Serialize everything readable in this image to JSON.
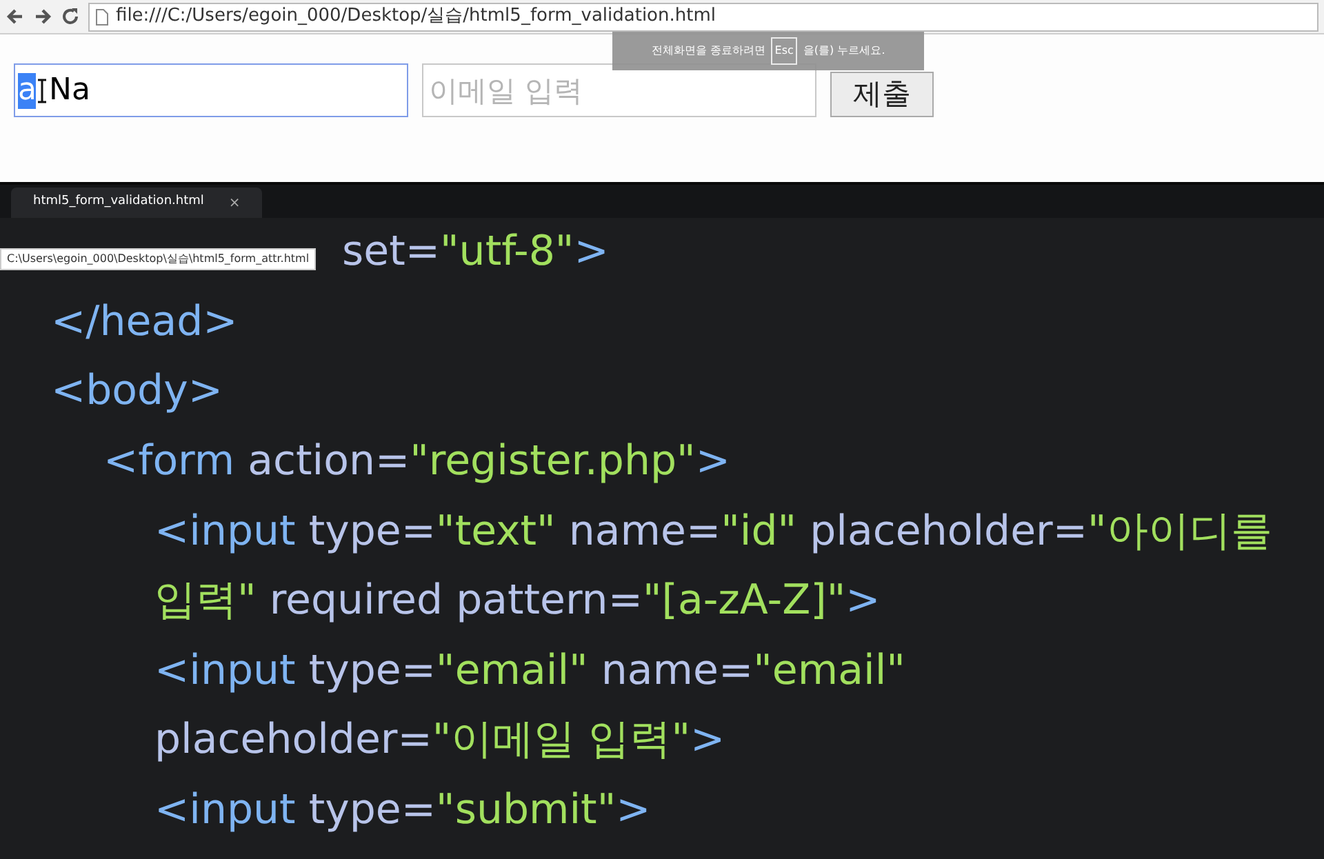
{
  "browser": {
    "url": "file:///C:/Users/egoin_000/Desktop/실습/html5_form_validation.html"
  },
  "fullscreen_notice": {
    "before": "전체화면을 종료하려면",
    "key": "Esc",
    "after": "을(를) 누르세요."
  },
  "form": {
    "id_field": {
      "value_selected": "a",
      "value_rest": "Na",
      "focused": true
    },
    "email_field": {
      "placeholder": "이메일 입력",
      "focused": false
    },
    "submit_button": "제출"
  },
  "editor": {
    "tab": {
      "label": "html5_form_validation.html",
      "close": "×",
      "selected": true
    },
    "tooltip": "C:\\Users\\egoin_000\\Desktop\\실습\\html5_form_attr.html",
    "code_lines": [
      {
        "children": [
          {
            "tokens": [
              {
                "kind": "attr",
                "text": "set="
              },
              {
                "kind": "string",
                "text": "\"utf-8\""
              },
              {
                "kind": "tag",
                "text": ">"
              }
            ]
          }
        ]
      },
      {
        "tokens": [
          {
            "kind": "tag",
            "text": "</head>"
          }
        ]
      },
      {
        "tokens": [
          {
            "kind": "tag",
            "text": "<body>"
          }
        ],
        "children": [
          {
            "tokens": [
              {
                "kind": "tag",
                "text": "<form"
              },
              {
                "kind": "attr",
                "text": " action="
              },
              {
                "kind": "string",
                "text": "\"register.php\""
              },
              {
                "kind": "tag",
                "text": ">"
              }
            ],
            "children": [
              {
                "tokens": [
                  {
                    "kind": "tag",
                    "text": "<input"
                  },
                  {
                    "kind": "attr",
                    "text": " type="
                  },
                  {
                    "kind": "string",
                    "text": "\"text\""
                  },
                  {
                    "kind": "attr",
                    "text": " name="
                  },
                  {
                    "kind": "string",
                    "text": "\"id\""
                  },
                  {
                    "kind": "attr",
                    "text": " placeholder="
                  },
                  {
                    "kind": "string",
                    "text": "\"아이디를"
                  }
                ]
              },
              {
                "tokens": [
                  {
                    "kind": "string",
                    "text": "입력\""
                  },
                  {
                    "kind": "attr",
                    "text": " required pattern="
                  },
                  {
                    "kind": "string",
                    "text": "\"[a-zA-Z]\""
                  },
                  {
                    "kind": "tag",
                    "text": ">"
                  }
                ]
              },
              {
                "tokens": [
                  {
                    "kind": "tag",
                    "text": "<input"
                  },
                  {
                    "kind": "attr",
                    "text": " type="
                  },
                  {
                    "kind": "string",
                    "text": "\"email\""
                  },
                  {
                    "kind": "attr",
                    "text": " name="
                  },
                  {
                    "kind": "string",
                    "text": "\"email\""
                  }
                ]
              },
              {
                "tokens": [
                  {
                    "kind": "attr",
                    "text": "placeholder="
                  },
                  {
                    "kind": "string",
                    "text": "\"이메일 입력\""
                  },
                  {
                    "kind": "tag",
                    "text": ">"
                  }
                ]
              },
              {
                "tokens": [
                  {
                    "kind": "tag",
                    "text": "<input"
                  },
                  {
                    "kind": "attr",
                    "text": " type="
                  },
                  {
                    "kind": "string",
                    "text": "\"submit\""
                  },
                  {
                    "kind": "tag",
                    "text": ">"
                  }
                ]
              }
            ]
          }
        ]
      }
    ]
  }
}
